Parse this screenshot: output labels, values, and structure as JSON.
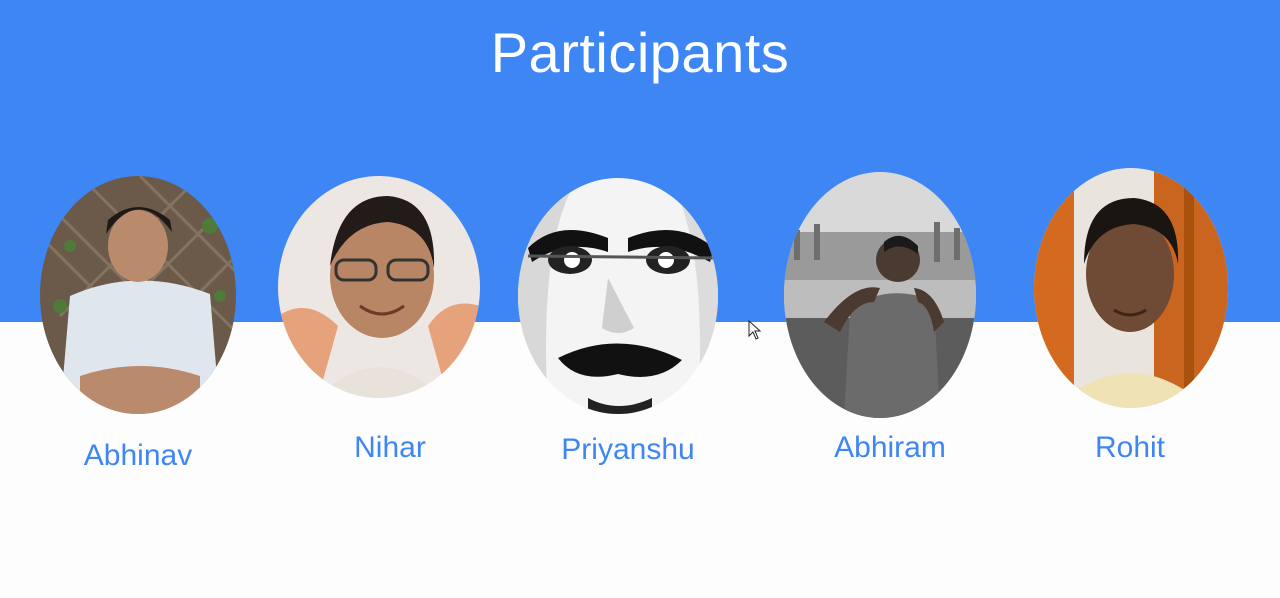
{
  "slide": {
    "title": "Participants",
    "accent_color": "#3d86f4"
  },
  "participants": [
    {
      "name": "Abhinav"
    },
    {
      "name": "Nihar"
    },
    {
      "name": "Priyanshu"
    },
    {
      "name": "Abhiram"
    },
    {
      "name": "Rohit"
    }
  ],
  "icons": {
    "cursor": "mouse-pointer-icon"
  }
}
